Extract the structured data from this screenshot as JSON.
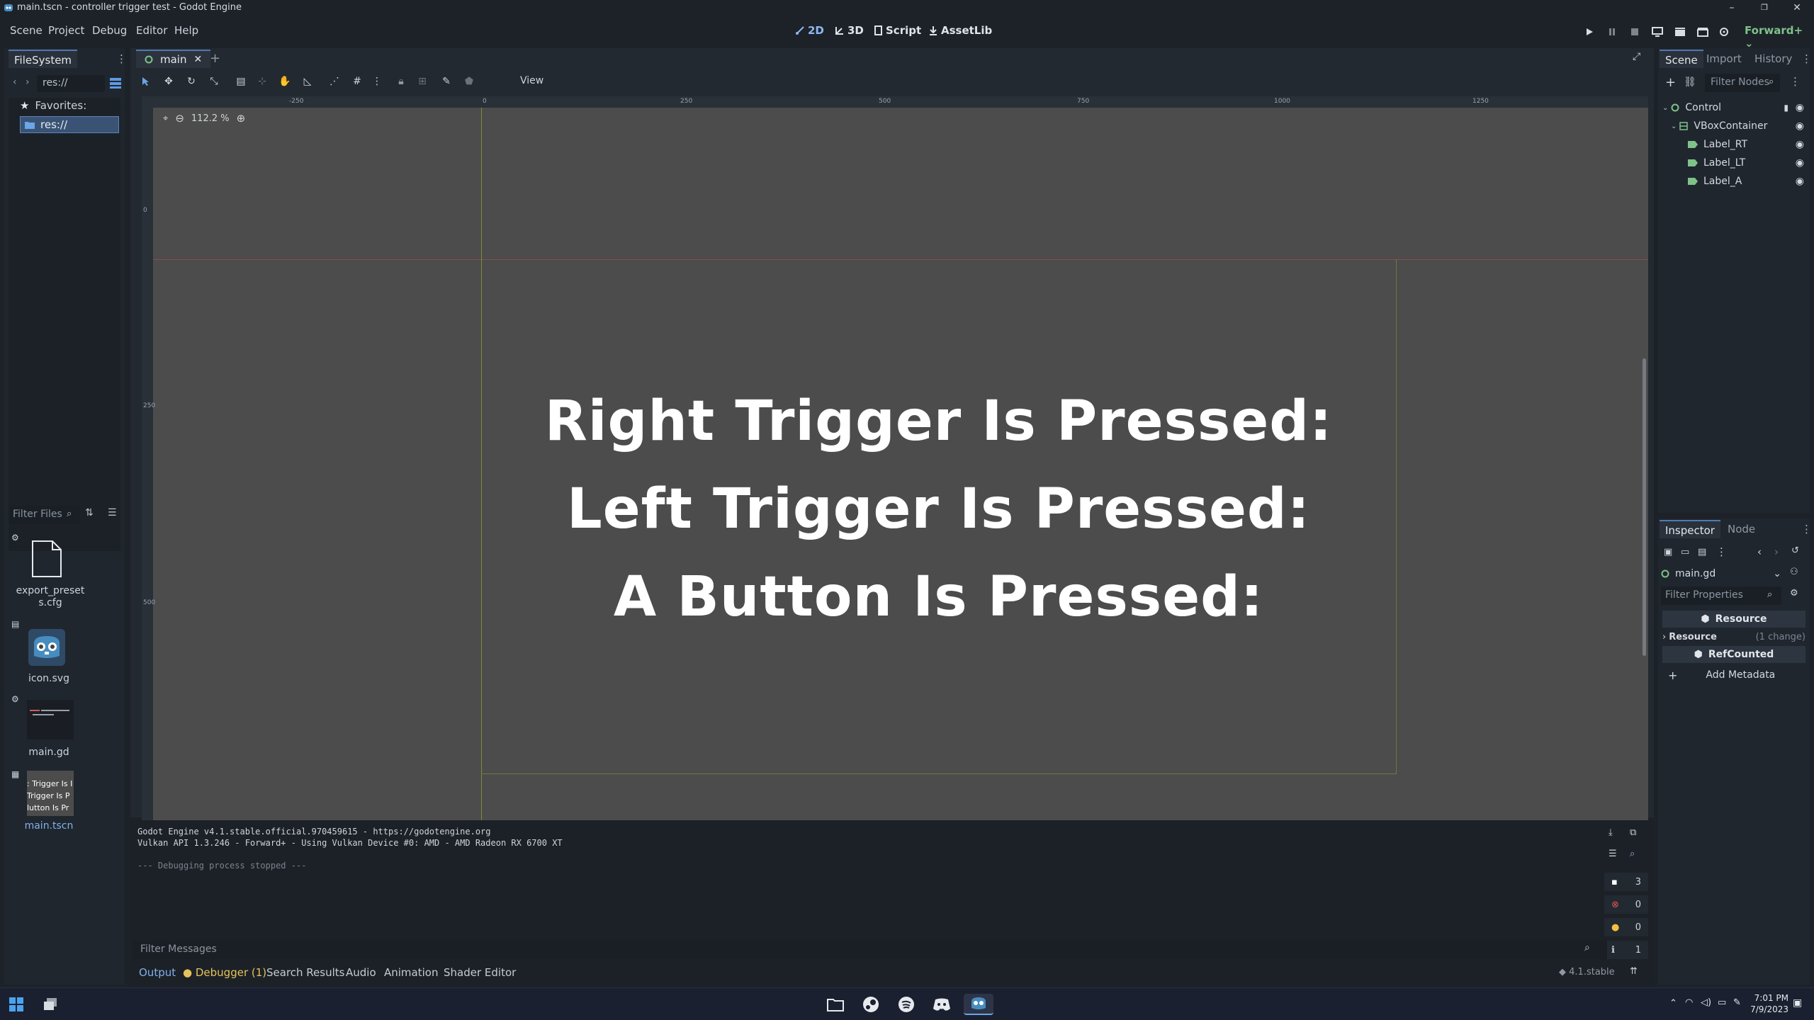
{
  "window": {
    "title": "main.tscn - controller trigger test - Godot Engine",
    "controls": [
      "–",
      "❐",
      "✕"
    ]
  },
  "menu": {
    "items": [
      "Scene",
      "Project",
      "Debug",
      "Editor",
      "Help"
    ]
  },
  "workspaces": {
    "items": [
      "2D",
      "3D",
      "Script",
      "AssetLib"
    ],
    "active": "2D"
  },
  "renderer": "Forward+",
  "filesystem": {
    "tab": "FileSystem",
    "path": "res://",
    "favorites_label": "Favorites:",
    "root": "res://",
    "filter_placeholder": "Filter Files",
    "files": [
      {
        "name": "export_presets.cfg",
        "icon": "file-icon"
      },
      {
        "name": "icon.svg",
        "icon": "godot-icon"
      },
      {
        "name": "main.gd",
        "icon": "script-thumb"
      },
      {
        "name": "main.tscn",
        "icon": "scene-thumb"
      }
    ],
    "scene_thumb_lines": [
      ": Trigger Is I",
      "Trigger Is P",
      "lutton Is Pr"
    ]
  },
  "scene_tabs": {
    "active": "main",
    "add": "+"
  },
  "toolbar": {
    "view_label": "View"
  },
  "canvas": {
    "zoom": "112.2 %",
    "ruler_top": [
      "-250",
      "0",
      "250",
      "500",
      "750",
      "1000",
      "1250"
    ],
    "ruler_left": [
      "0",
      "250",
      "500"
    ],
    "labels": [
      "Right Trigger Is Pressed:",
      "Left Trigger Is Pressed:",
      "A Button Is Pressed:"
    ]
  },
  "output": {
    "lines": [
      "Godot Engine v4.1.stable.official.970459615 - https://godotengine.org",
      "Vulkan API 1.3.246 - Forward+ - Using Vulkan Device #0: AMD - AMD Radeon RX 6700 XT"
    ],
    "stopped": "--- Debugging process stopped ---",
    "filter_placeholder": "Filter Messages",
    "counts": {
      "messages": "3",
      "errors": "0",
      "warnings": "0",
      "info": "1"
    }
  },
  "bottom_tabs": {
    "items": [
      "Output",
      "Debugger (1)",
      "Search Results",
      "Audio",
      "Animation",
      "Shader Editor"
    ],
    "active": "Output",
    "version": "4.1.stable"
  },
  "scene_dock": {
    "tabs": [
      "Scene",
      "Import",
      "History"
    ],
    "active": "Scene",
    "filter_placeholder": "Filter Nodes",
    "nodes": [
      {
        "name": "Control",
        "depth": 0
      },
      {
        "name": "VBoxContainer",
        "depth": 1
      },
      {
        "name": "Label_RT",
        "depth": 2
      },
      {
        "name": "Label_LT",
        "depth": 2
      },
      {
        "name": "Label_A",
        "depth": 2
      }
    ]
  },
  "inspector": {
    "tabs": [
      "Inspector",
      "Node"
    ],
    "active": "Inspector",
    "resource_name": "main.gd",
    "filter_placeholder": "Filter Properties",
    "section_resource": "Resource",
    "property_resource": "Resource",
    "property_changes": "(1 change)",
    "section_refcounted": "RefCounted",
    "add_metadata": "Add Metadata"
  },
  "taskbar": {
    "time": "7:01 PM",
    "date": "7/9/2023"
  },
  "colors": {
    "accent": "#4e7ab0",
    "canvas_bg": "#4c4c4c",
    "active_tab_text": "#7fb0ec"
  }
}
